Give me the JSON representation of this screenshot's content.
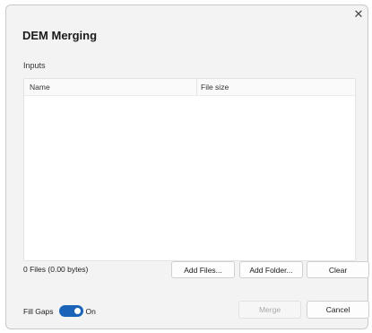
{
  "dialog": {
    "title": "DEM Merging",
    "close_glyph": "✕",
    "inputs_label": "Inputs",
    "table": {
      "columns": [
        "Name",
        "File size"
      ],
      "rows": []
    },
    "files_summary": "0 Files (0.00 bytes)",
    "buttons": {
      "add_files": "Add Files...",
      "add_folder": "Add Folder...",
      "clear": "Clear",
      "merge": "Merge",
      "cancel": "Cancel"
    },
    "fill_gaps": {
      "label": "Fill Gaps",
      "state": "On",
      "enabled": true
    }
  },
  "colors": {
    "accent": "#1a63b8",
    "dialog_bg": "#f3f3f3"
  }
}
